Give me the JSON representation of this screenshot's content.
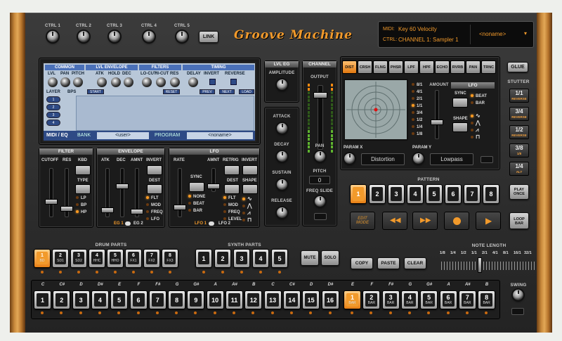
{
  "brand": {
    "title": "Groove Machine"
  },
  "top": {
    "ctrls": [
      "CTRL 1",
      "CTRL 2",
      "CTRL 3",
      "CTRL 4",
      "CTRL 5"
    ],
    "link": "LINK"
  },
  "display": {
    "midi_label": "MIDI:",
    "midi_value": "Key 60 Velocity",
    "ctrl_label": "CTRL:",
    "ctrl_value": "CHANNEL 1: Sampler 1",
    "preset": "<noname>"
  },
  "lcd": {
    "sections": [
      "COMMON",
      "LVL ENVELOPE",
      "FILTERS",
      "TIMING"
    ],
    "knobs": [
      "LVL",
      "PAN",
      "PITCH",
      "ATK",
      "HOLD",
      "DEC",
      "LO-CUT",
      "HI-CUT",
      "RES",
      "DELAY",
      "INVERT",
      "REVERSE"
    ],
    "cols": [
      "LAYER",
      "BPS"
    ],
    "start": "START",
    "reset": "RESET",
    "prev": "PREV",
    "next": "NEXT",
    "load": "LOAD",
    "layers": [
      "1",
      "2",
      "3",
      "4"
    ],
    "tab": "MIDI / EQ",
    "bank_label": "BANK",
    "bank_value": "<user>",
    "program_label": "PROGRAM",
    "program_value": "<noname>"
  },
  "lvl_eg": {
    "title": "LVL EG",
    "amplitude": "AMPLITUDE",
    "attack": "ATTACK",
    "decay": "DECAY",
    "sustain": "SUSTAIN",
    "release": "RELEASE"
  },
  "channel": {
    "title": "CHANNEL",
    "output": "OUTPUT",
    "pan": "PAN",
    "pitch": "PITCH",
    "pitch_value": "0",
    "freq_slide": "FREQ SLIDE"
  },
  "filter": {
    "title": "FILTER",
    "labels": [
      "CUTOFF",
      "RES",
      "KBD"
    ],
    "type": "TYPE",
    "modes": [
      "LP",
      "BP",
      "HP"
    ],
    "active_mode": "HP"
  },
  "envelope": {
    "title": "ENVELOPE",
    "labels": [
      "ATK",
      "DEC",
      "AMNT",
      "INVERT"
    ],
    "dest": "DEST",
    "dests": [
      "FLT",
      "MOD",
      "FREQ",
      "LFO"
    ],
    "eg1": "EG 1",
    "eg2": "EG 2"
  },
  "lfo": {
    "title": "LFO",
    "labels": [
      "RATE",
      "AMNT",
      "RETRIG",
      "INVERT"
    ],
    "sync": "SYNC",
    "syncs": [
      "NONE",
      "BEAT",
      "BAR"
    ],
    "dest": "DEST",
    "dests": [
      "FLT",
      "MOD",
      "FREQ",
      "LEVEL"
    ],
    "shape": "SHAPE",
    "lfo1": "LFO 1",
    "lfo2": "LFO 2"
  },
  "fx": {
    "buttons": [
      "DIST",
      "CRSH",
      "FLNG",
      "PHSR",
      "LPF",
      "HPF",
      "ECHO",
      "RVRB",
      "PAN",
      "TRNC"
    ],
    "active": "DIST",
    "rates": [
      "8/1",
      "4/1",
      "2/1",
      "1/1",
      "3/4",
      "1/2",
      "1/4",
      "1/8"
    ],
    "amount": "AMOUNT",
    "lfo": "LFO",
    "sync": "SYNC",
    "beat": "BEAT",
    "bar": "BAR",
    "shape": "SHAPE",
    "param_x": "PARAM X",
    "param_x_value": "Distortion",
    "param_y": "PARAM Y",
    "param_y_value": "Lowpass"
  },
  "glue": "GLUE",
  "stutter": {
    "title": "STUTTER",
    "items": [
      {
        "v": "1/1",
        "s": "REVERSE"
      },
      {
        "v": "3/4",
        "s": "REVERSE"
      },
      {
        "v": "1/2",
        "s": "REVERSE"
      },
      {
        "v": "3/8",
        "s": "1/8"
      },
      {
        "v": "1/4",
        "s": "ALT"
      }
    ]
  },
  "pattern": {
    "title": "PATTERN",
    "keys": [
      "1",
      "2",
      "3",
      "4",
      "5",
      "6",
      "7",
      "8"
    ],
    "active": "1",
    "play_once": "PLAY ONCE",
    "loop_bar": "LOOP BAR",
    "edit_mode": "EDIT MODE"
  },
  "drum": {
    "title": "DRUM PARTS",
    "parts": [
      {
        "n": "1",
        "s": "BD"
      },
      {
        "n": "2",
        "s": "SD1"
      },
      {
        "n": "3",
        "s": "SD2"
      },
      {
        "n": "4",
        "s": "HHC"
      },
      {
        "n": "5",
        "s": "HHO"
      },
      {
        "n": "6",
        "s": "FX1"
      },
      {
        "n": "7",
        "s": "FX2"
      },
      {
        "n": "8",
        "s": "FX3"
      }
    ]
  },
  "synth": {
    "title": "SYNTH PARTS",
    "parts": [
      "1",
      "2",
      "3",
      "4",
      "5"
    ]
  },
  "mute": "MUTE",
  "solo": "SOLO",
  "copy": "COPY",
  "paste": "PASTE",
  "clear": "CLEAR",
  "note_length": {
    "title": "NOTE LENGTH",
    "values": [
      "1/8",
      "1/4",
      "1/2",
      "1/1",
      "2/1",
      "4/1",
      "8/1",
      "16/1",
      "32/1"
    ]
  },
  "swing": "SWING",
  "steps": {
    "notes": [
      "C",
      "C#",
      "D",
      "D#",
      "E",
      "F",
      "F#",
      "G",
      "G#",
      "A",
      "A#",
      "B",
      "C",
      "C#",
      "D",
      "D#"
    ],
    "numbers": [
      "1",
      "2",
      "3",
      "4",
      "5",
      "6",
      "7",
      "8",
      "9",
      "10",
      "11",
      "12",
      "13",
      "14",
      "15",
      "16"
    ]
  },
  "bars": {
    "notes": [
      "E",
      "F",
      "F#",
      "G",
      "G#",
      "A",
      "A#",
      "B"
    ],
    "numbers": [
      "1",
      "2",
      "3",
      "4",
      "5",
      "6",
      "7",
      "8"
    ],
    "sub": "BAR"
  }
}
